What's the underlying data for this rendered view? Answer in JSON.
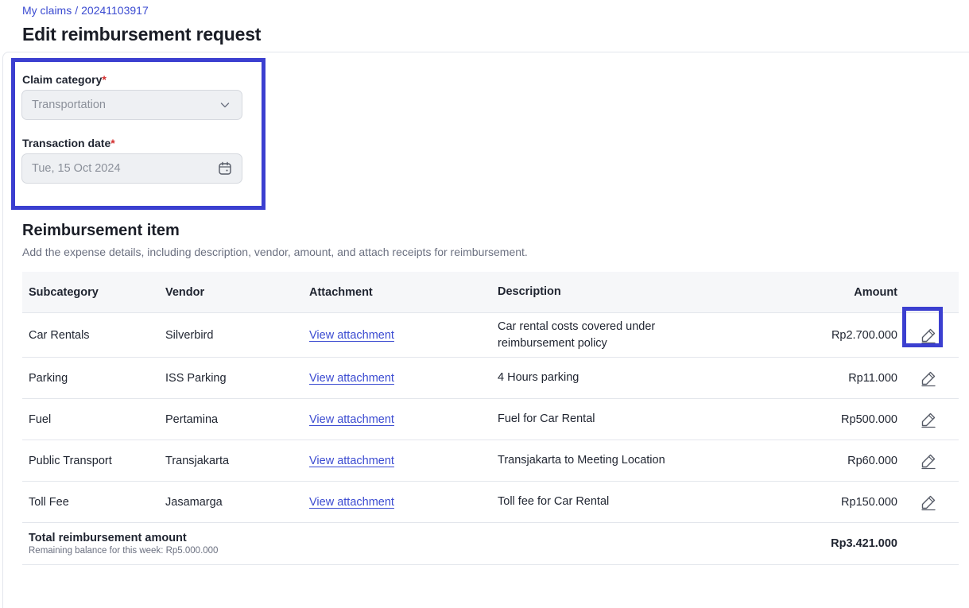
{
  "breadcrumb": {
    "parent": "My claims",
    "separator": "/",
    "current": "20241103917"
  },
  "page": {
    "title": "Edit reimbursement request"
  },
  "form": {
    "category_label": "Claim category",
    "category_value": "Transportation",
    "date_label": "Transaction date",
    "date_value": "Tue, 15 Oct 2024",
    "required_mark": "*"
  },
  "items_section": {
    "title": "Reimbursement item",
    "description": "Add the expense details, including description, vendor, amount, and attach receipts for reimbursement."
  },
  "table": {
    "headers": {
      "subcategory": "Subcategory",
      "vendor": "Vendor",
      "attachment": "Attachment",
      "description": "Description",
      "amount": "Amount"
    },
    "rows": [
      {
        "subcategory": "Car Rentals",
        "vendor": "Silverbird",
        "attachment": "View attachment",
        "description": "Car rental costs covered under reimbursement policy",
        "amount": "Rp2.700.000"
      },
      {
        "subcategory": "Parking",
        "vendor": "ISS Parking",
        "attachment": "View attachment",
        "description": "4 Hours parking",
        "amount": "Rp11.000"
      },
      {
        "subcategory": "Fuel",
        "vendor": "Pertamina",
        "attachment": "View attachment",
        "description": "Fuel for Car Rental",
        "amount": "Rp500.000"
      },
      {
        "subcategory": "Public Transport",
        "vendor": "Transjakarta",
        "attachment": "View attachment",
        "description": "Transjakarta to Meeting Location",
        "amount": "Rp60.000"
      },
      {
        "subcategory": "Toll Fee",
        "vendor": "Jasamarga",
        "attachment": "View attachment",
        "description": "Toll fee for Car Rental",
        "amount": "Rp150.000"
      }
    ],
    "total": {
      "label": "Total reimbursement amount",
      "balance_note": "Remaining balance for this week: Rp5.000.000",
      "amount": "Rp3.421.000"
    }
  },
  "icons": {
    "dropdown": "chevron-down-icon",
    "date": "calendar-icon",
    "edit": "pencil-icon"
  },
  "colors": {
    "accent": "#3b4bd1",
    "highlight": "#3b3fd0",
    "required": "#d22e2e"
  }
}
